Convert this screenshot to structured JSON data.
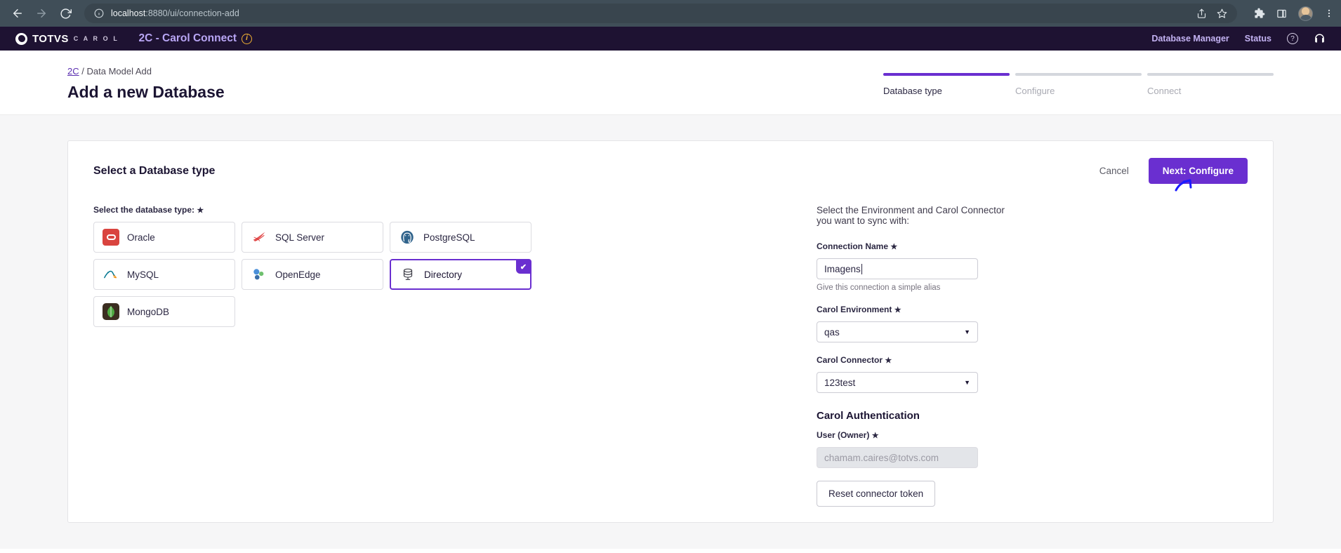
{
  "browser": {
    "url_host": "localhost",
    "url_path": ":8880/ui/connection-add",
    "back_icon": "back-arrow-icon",
    "forward_icon": "forward-arrow-icon",
    "reload_icon": "reload-icon",
    "info_icon": "site-info-icon",
    "share_icon": "share-icon",
    "bookmark_icon": "star-icon",
    "extensions_icon": "puzzle-icon",
    "sidepanel_icon": "side-panel-icon",
    "profile_icon": "avatar",
    "menu_icon": "three-dot-menu-icon"
  },
  "app_header": {
    "brand_totvs": "TOTVS",
    "brand_carol": "C A R O L",
    "title": "2C - Carol Connect",
    "info_badge": "i",
    "links": [
      {
        "label": "Database Manager"
      },
      {
        "label": "Status"
      }
    ],
    "help_icon": "question-mark-icon",
    "support_icon": "headset-icon"
  },
  "page": {
    "breadcrumb_link": "2C",
    "breadcrumb_sep": "/",
    "breadcrumb_current": "Data Model Add",
    "title": "Add a new Database"
  },
  "stepper": {
    "steps": [
      {
        "label": "Database type",
        "active": true
      },
      {
        "label": "Configure",
        "active": false
      },
      {
        "label": "Connect",
        "active": false
      }
    ],
    "active_color": "#6a2fd0",
    "inactive_color": "#d4d7dd"
  },
  "card": {
    "title": "Select a Database type",
    "cancel_label": "Cancel",
    "next_label": "Next: Configure",
    "db_type_label": "Select the database type:",
    "required_mark": "★",
    "tiles": [
      {
        "label": "Oracle",
        "icon": "oracle-logo-icon",
        "selected": false
      },
      {
        "label": "SQL Server",
        "icon": "sqlserver-logo-icon",
        "selected": false
      },
      {
        "label": "PostgreSQL",
        "icon": "postgresql-logo-icon",
        "selected": false
      },
      {
        "label": "MySQL",
        "icon": "mysql-logo-icon",
        "selected": false
      },
      {
        "label": "OpenEdge",
        "icon": "openedge-logo-icon",
        "selected": false
      },
      {
        "label": "Directory",
        "icon": "directory-logo-icon",
        "selected": true
      },
      {
        "label": "MongoDB",
        "icon": "mongodb-logo-icon",
        "selected": false
      }
    ],
    "check_glyph": "✔"
  },
  "form": {
    "intro": "Select the Environment and Carol Connector you want to sync with:",
    "connection_name": {
      "label": "Connection Name",
      "value": "Imagens",
      "placeholder": "Connection Name",
      "hint": "Give this connection a simple alias"
    },
    "carol_environment": {
      "label": "Carol Environment",
      "value": "qas",
      "options": [
        "qas"
      ]
    },
    "carol_connector": {
      "label": "Carol Connector",
      "value": "123test",
      "options": [
        "123test"
      ]
    },
    "auth_section_title": "Carol Authentication",
    "user_owner": {
      "label": "User (Owner)",
      "value": "chamam.caires@totvs.com"
    },
    "reset_token_label": "Reset connector token",
    "chevron_glyph": "▼"
  },
  "cursor": {
    "name": "arrow-cursor",
    "color": "#1a1aff"
  }
}
